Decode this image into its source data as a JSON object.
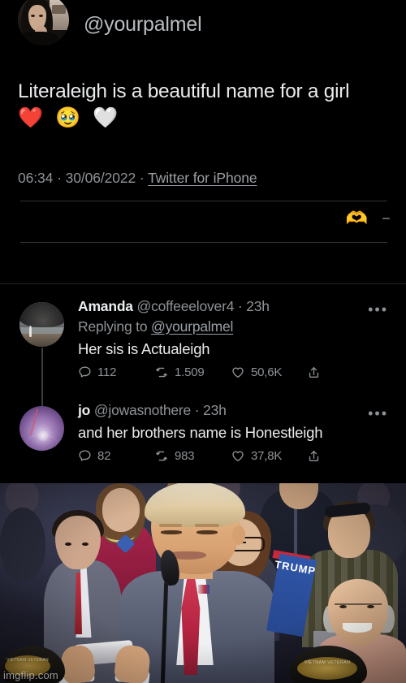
{
  "meme": {
    "watermark": "imgflip.com"
  },
  "tweet": {
    "handle": "@yourpalmel",
    "text": "Literaleigh is a beautiful name for a girl",
    "emojis": "❤️ 🥹 🤍",
    "time": "06:34",
    "separator": "·",
    "date": "30/06/2022",
    "source": "Twitter for iPhone",
    "reaction_emoji": "🫶",
    "avatar_icon": "profile-photo-woman"
  },
  "replies": [
    {
      "name": "Amanda",
      "handle": "@coffeeelover4",
      "time": "23h",
      "replying_to_label": "Replying to",
      "replying_to_handle": "@yourpalmel",
      "text": "Her sis is Actualeigh",
      "more_icon": "•••",
      "actions": {
        "reply_icon": "comment-icon",
        "reply_count": "112",
        "retweet_icon": "retweet-icon",
        "retweet_count": "1.509",
        "like_icon": "heart-icon",
        "like_count": "50,6K",
        "share_icon": "share-icon"
      }
    },
    {
      "name": "jo",
      "handle": "@jowasnothere",
      "time": "23h",
      "text": "and her brothers name is Honestleigh",
      "more_icon": "•••",
      "actions": {
        "reply_icon": "comment-icon",
        "reply_count": "82",
        "retweet_icon": "retweet-icon",
        "retweet_count": "983",
        "like_icon": "heart-icon",
        "like_count": "37,8K",
        "share_icon": "share-icon"
      }
    }
  ],
  "photo": {
    "sign_text": "TRUMP",
    "cap_left_text": "VIETNAM VETERAN",
    "cap_right_text": "VIETNAM VETERAN",
    "description": "man-reading-phone-at-rally"
  },
  "colors": {
    "background": "#000000",
    "text_primary": "#e9eaec",
    "text_secondary": "#8e9296",
    "link": "#9aa0a6",
    "divider": "#2e3336"
  }
}
